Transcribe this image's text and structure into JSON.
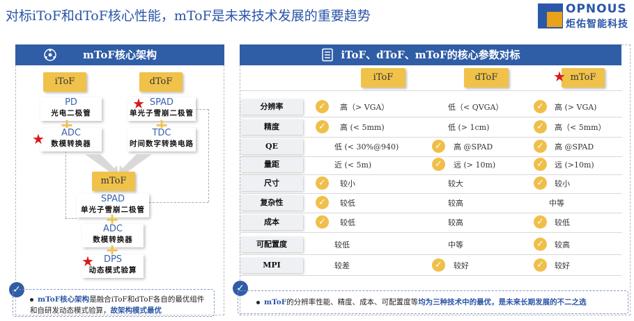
{
  "title": "对标iToF和dToF核心性能，mToF是未来技术发展的重要趋势",
  "logo": {
    "brand": "OPNOUS",
    "brand_cn": "炬佑智能科技"
  },
  "left": {
    "header": "mToF核心架构",
    "tag_itof": "iToF",
    "tag_dtof": "dToF",
    "tag_mtof": "mToF",
    "pd_en": "PD",
    "pd_cn": "光电二极管",
    "adc1_en": "ADC",
    "adc1_cn": "数模转换器",
    "spad1_en": "SPAD",
    "spad1_cn": "单光子雪崩二极管",
    "tdc_en": "TDC",
    "tdc_cn": "时间数字转换电路",
    "spad2_en": "SPAD",
    "spad2_cn": "单光子雪崩二极管",
    "adc2_en": "ADC",
    "adc2_cn": "数模转换器",
    "dps_en": "DPS",
    "dps_cn": "动态模式验算",
    "note_lead": "mToF核心架构",
    "note_mid": "是融合iToF和dToF各自的最优组件和自研发动态模式验算，",
    "note_tail": "故架构模式最优"
  },
  "right": {
    "header": "iToF、dToF、mToF的核心参数对标",
    "col_itof": "iToF",
    "col_dtof": "dToF",
    "col_mtof": "mToF",
    "rows": [
      {
        "label": "分辨率",
        "itof": "高（> VGA）",
        "dtof": "低（< QVGA）",
        "mtof": "高 (> VGA)"
      },
      {
        "label": "精度",
        "itof": "高 (< 5mm)",
        "dtof": "低 (> 1cm)",
        "mtof": "高（< 5mm）"
      },
      {
        "label": "QE",
        "itof": "低 (< 30%@940)",
        "dtof": "高 @SPAD",
        "mtof": "高 @SPAD"
      },
      {
        "label": "量距",
        "itof": "近 (< 5m)",
        "dtof": "远 (> 10m)",
        "mtof": "远 (>10m)"
      },
      {
        "label": "尺寸",
        "itof": "较小",
        "dtof": "较大",
        "mtof": "较小"
      },
      {
        "label": "复杂性",
        "itof": "较低",
        "dtof": "较高",
        "mtof": "中等"
      },
      {
        "label": "成本",
        "itof": "较低",
        "dtof": "较高",
        "mtof": "较低"
      },
      {
        "label": "可配置度",
        "itof": "较低",
        "dtof": "中等",
        "mtof": "较高"
      },
      {
        "label": "MPI",
        "itof": "较差",
        "dtof": "较好",
        "mtof": "较好"
      }
    ],
    "note_lead": "mToF",
    "note_mid": "的分辨率性能、精度、成本、可配置度等",
    "note_tail": "均为三种技术中的最优，是未来长期发展的不二之选"
  }
}
